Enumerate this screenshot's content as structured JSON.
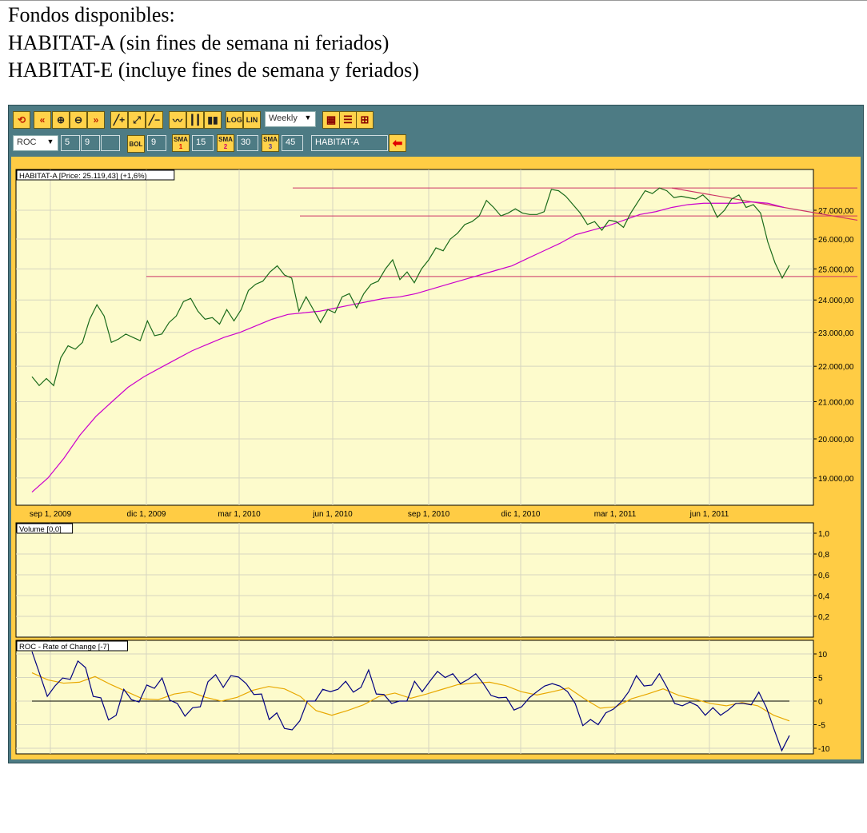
{
  "header": {
    "lines": [
      "Fondos disponibles:",
      "HABITAT-A (sin fines de semana ni feriados)",
      "HABITAT-E (incluye fines de semana y feriados)"
    ]
  },
  "toolbar": {
    "row1": [
      {
        "name": "refresh-icon",
        "label": "⟲"
      },
      {
        "name": "scroll-left-icon",
        "label": "«"
      },
      {
        "name": "zoom-in-icon",
        "label": "⊕"
      },
      {
        "name": "zoom-out-icon",
        "label": "⊖"
      },
      {
        "name": "scroll-right-icon",
        "label": "»"
      },
      {
        "name": "add-line-icon",
        "label": "╱+"
      },
      {
        "name": "parallel-lines-icon",
        "label": "⤢"
      },
      {
        "name": "remove-line-icon",
        "label": "╱−"
      },
      {
        "name": "line-chart-icon",
        "label": "〰"
      },
      {
        "name": "bar-chart-icon",
        "label": "┃┃"
      },
      {
        "name": "candlestick-icon",
        "label": "▮▮"
      },
      {
        "name": "log-button",
        "label": "LOG"
      },
      {
        "name": "lin-button",
        "label": "LIN"
      }
    ],
    "period": "Weekly",
    "row1_right": [
      {
        "name": "grid-icon",
        "label": "▦"
      },
      {
        "name": "legend-icon",
        "label": "☰"
      },
      {
        "name": "layout-icon",
        "label": "⊞"
      }
    ],
    "indicator": "ROC",
    "ind_params": [
      "5",
      "9",
      ""
    ],
    "bol_label": "BOL",
    "bol_value": "9",
    "sma": [
      {
        "label": "SMA",
        "num": "1",
        "value": "15",
        "numcolor": "#e00000"
      },
      {
        "label": "SMA",
        "num": "2",
        "value": "30",
        "numcolor": "#d00070"
      },
      {
        "label": "SMA",
        "num": "3",
        "value": "45",
        "numcolor": "#5030a0"
      }
    ],
    "symbol": "HABITAT-A",
    "go_icon": "arrow-left-icon"
  },
  "colors": {
    "price": "#1a6a1a",
    "sma": "#cc00cc",
    "trend": "#cc3366",
    "roc": "#000080",
    "roc_sma": "#e8a800",
    "panel": "#fdfbcc",
    "grid": "#d6d6c0"
  },
  "chart_data": [
    {
      "type": "line",
      "title": "HABITAT-A [Price: 25.119,43] (+1,6%)",
      "scale": "log",
      "ylim": [
        18200,
        28200
      ],
      "y_ticks": [
        "19.000,00",
        "20.000,00",
        "21.000,00",
        "22.000,00",
        "23.000,00",
        "24.000,00",
        "25.000,00",
        "26.000,00",
        "27.000,00"
      ],
      "y_tick_values": [
        19000,
        20000,
        21000,
        22000,
        23000,
        24000,
        25000,
        26000,
        27000
      ],
      "x_ticks": [
        "sep 1, 2009",
        "dic 1, 2009",
        "mar 1, 2010",
        "jun 1, 2010",
        "sep 1, 2010",
        "dic 1, 2010",
        "mar 1, 2011",
        "jun 1, 2011"
      ],
      "grid": true,
      "series": [
        {
          "values": [
            21700,
            21450,
            21650,
            21450,
            22250,
            22600,
            22500,
            22700,
            23400,
            23850,
            23500,
            22700,
            22800,
            22950,
            22850,
            22750,
            23350,
            22900,
            22950,
            23300,
            23500,
            23950,
            24050,
            23650,
            23400,
            23450,
            23250,
            23700,
            23350,
            23700,
            24300,
            24500,
            24600,
            24900,
            25100,
            24800,
            24700,
            23650,
            24100,
            23700,
            23300,
            23700,
            23600,
            24100,
            24200,
            23750,
            24200,
            24500,
            24600,
            25000,
            25300,
            24650,
            24900,
            24550,
            25000,
            25300,
            25700,
            25600,
            26000,
            26200,
            26500,
            26600,
            26800,
            27350,
            27100,
            26800,
            26900,
            27050,
            26900,
            26850,
            26850,
            26950,
            27750,
            27700,
            27500,
            27200,
            26900,
            26500,
            26600,
            26300,
            26650,
            26600,
            26400,
            26900,
            27300,
            27700,
            27600,
            27800,
            27700,
            27450,
            27500,
            27450,
            27400,
            27550,
            27300,
            26750,
            27000,
            27400,
            27550,
            27100,
            27200,
            26900,
            25900,
            25200,
            24700,
            25119
          ]
        },
        {
          "values": [
            18650,
            19000,
            19500,
            20100,
            20600,
            21000,
            21400,
            21700,
            21950,
            22200,
            22450,
            22650,
            22850,
            23000,
            23200,
            23400,
            23550,
            23600,
            23650,
            23750,
            23850,
            23950,
            24050,
            24100,
            24200,
            24350,
            24500,
            24650,
            24800,
            24950,
            25100,
            25350,
            25600,
            25850,
            26150,
            26300,
            26450,
            26650,
            26850,
            26950,
            27100,
            27200,
            27250,
            27250,
            27250,
            27300,
            27250,
            27100
          ]
        }
      ],
      "annotations": {
        "horizontal_lines": [
          27800,
          26800,
          24750
        ],
        "trend_line": {
          "from": 27800,
          "to": 26650
        }
      }
    },
    {
      "type": "bar",
      "title": "Volume [0,0]",
      "ylim": [
        0,
        1
      ],
      "y_ticks": [
        "0,2",
        "0,4",
        "0,6",
        "0,8",
        "1,0"
      ],
      "y_tick_values": [
        0.2,
        0.4,
        0.6,
        0.8,
        1.0
      ],
      "values": []
    },
    {
      "type": "line",
      "title": "ROC - Rate of Change [-7]",
      "ylim": [
        -11,
        12
      ],
      "y_ticks": [
        "10",
        "5",
        "0",
        "-5",
        "-10"
      ],
      "y_tick_values": [
        10,
        5,
        0,
        -5,
        -10
      ],
      "series": [
        {
          "values": [
            10.5,
            5.8,
            1,
            3.2,
            4.9,
            4.6,
            8.5,
            7.1,
            1,
            0.7,
            -4,
            -3,
            2.5,
            0.3,
            -0.2,
            3.4,
            2.7,
            4.9,
            0.2,
            -0.5,
            -3.2,
            -1.4,
            -1.2,
            4.1,
            5.6,
            2.9,
            5.4,
            5.1,
            3.7,
            1.4,
            1.5,
            -3.9,
            -2.5,
            -5.8,
            -6.1,
            -4.2,
            0,
            0,
            2.5,
            2,
            2.5,
            4.2,
            1.9,
            2.9,
            6.6,
            1.5,
            1.4,
            -0.5,
            0,
            0,
            4.2,
            2,
            4.2,
            6.3,
            5,
            5.8,
            3.7,
            4.6,
            5.8,
            3.7,
            1.2,
            0.7,
            0.8,
            -1.9,
            -1.2,
            0.7,
            2,
            3.2,
            3.7,
            3.2,
            2,
            -0.5,
            -5.2,
            -3.9,
            -5,
            -2.5,
            -1.7,
            -0.2,
            2,
            5.4,
            3.2,
            3.4,
            5.8,
            2.9,
            -0.5,
            -1,
            -0.2,
            -1,
            -3,
            -1.4,
            -3,
            -1.9,
            -0.5,
            -0.5,
            -0.8,
            1.9,
            -1.4,
            -6,
            -10.5,
            -7.3
          ]
        },
        {
          "values": [
            6,
            4.5,
            3.8,
            4,
            5.2,
            3.5,
            2,
            0.5,
            0.3,
            1.5,
            2,
            0.8,
            0,
            0.8,
            2.3,
            3.1,
            2.6,
            1,
            -2,
            -3,
            -2,
            -0.8,
            1,
            1.7,
            0.6,
            1.5,
            2.5,
            3.5,
            3.8,
            4,
            3.3,
            2,
            1.3,
            2,
            2.8,
            0.5,
            -1.5,
            -1.2,
            0.5,
            1.5,
            2.6,
            1.2,
            0.4,
            -0.5,
            -1,
            -0.3,
            -1,
            -3,
            -4.2
          ]
        }
      ]
    }
  ]
}
